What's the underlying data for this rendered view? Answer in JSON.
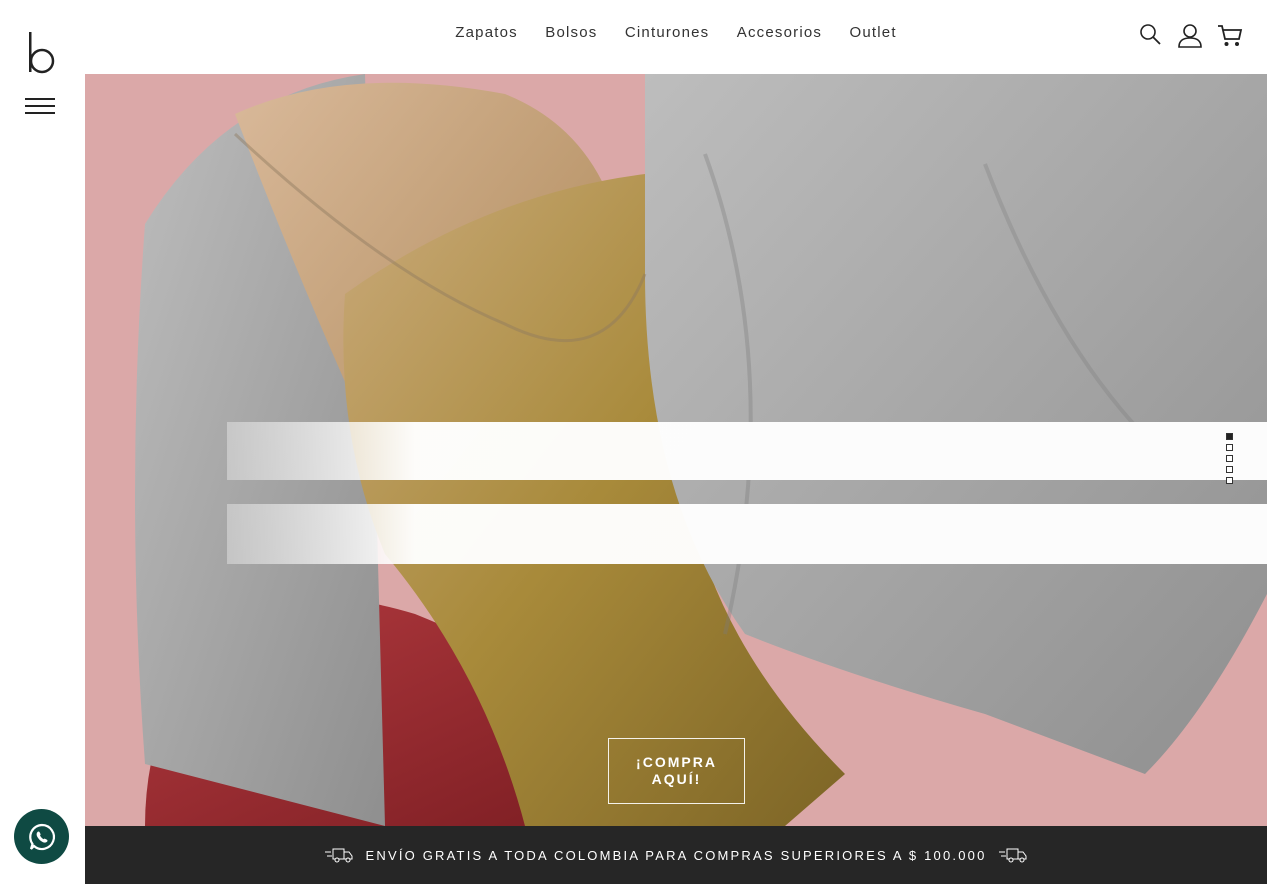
{
  "brand": {
    "logo_icon": "b-logo-icon"
  },
  "nav": {
    "items": [
      {
        "label": "Zapatos"
      },
      {
        "label": "Bolsos"
      },
      {
        "label": "Cinturones"
      },
      {
        "label": "Accesorios"
      },
      {
        "label": "Outlet"
      }
    ]
  },
  "header_icons": [
    "search-icon",
    "user-icon",
    "cart-icon"
  ],
  "hero": {
    "cta_label": "¡COMPRA AQUÍ!",
    "slides_total": 5,
    "active_slide": 1,
    "colors": {
      "background": "#dba8a8",
      "accent_gold": "#b59a4a"
    }
  },
  "shipping_banner": {
    "text": "ENVÍO GRATIS A TODA COLOMBIA PARA COMPRAS SUPERIORES A $ 100.000",
    "icon": "truck-icon"
  },
  "whatsapp": {
    "icon": "whatsapp-icon",
    "color": "#0f4a43"
  }
}
